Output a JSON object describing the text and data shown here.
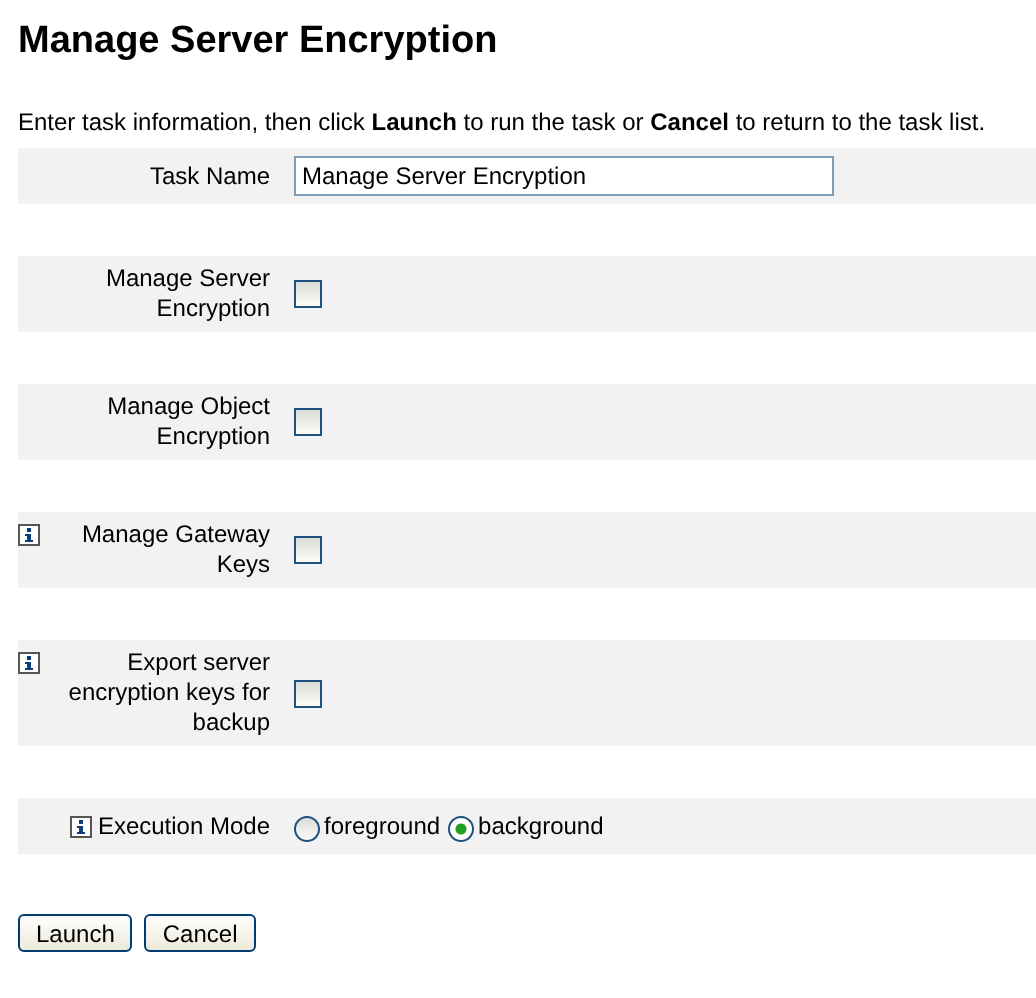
{
  "title": "Manage Server Encryption",
  "intro": "Enter task information, then click **Launch** to run the task or **Cancel** to return to the task list.",
  "fields": [
    {
      "kind": "text",
      "label": "Task Name",
      "info": false,
      "value": "Manage Server Encryption"
    },
    {
      "kind": "checkbox",
      "label": "Manage Server Encryption",
      "info": false,
      "checked": false
    },
    {
      "kind": "checkbox",
      "label": "Manage Object Encryption",
      "info": false,
      "checked": false
    },
    {
      "kind": "checkbox",
      "label": "Manage Gateway Keys",
      "info": true,
      "checked": false
    },
    {
      "kind": "checkbox",
      "label": "Export server encryption keys for backup",
      "info": true,
      "checked": false
    },
    {
      "kind": "radio",
      "label": "Execution Mode",
      "info": true,
      "options": [
        {
          "label": "foreground",
          "selected": false
        },
        {
          "label": "background",
          "selected": true
        }
      ]
    }
  ],
  "buttons": [
    "Launch",
    "Cancel"
  ]
}
